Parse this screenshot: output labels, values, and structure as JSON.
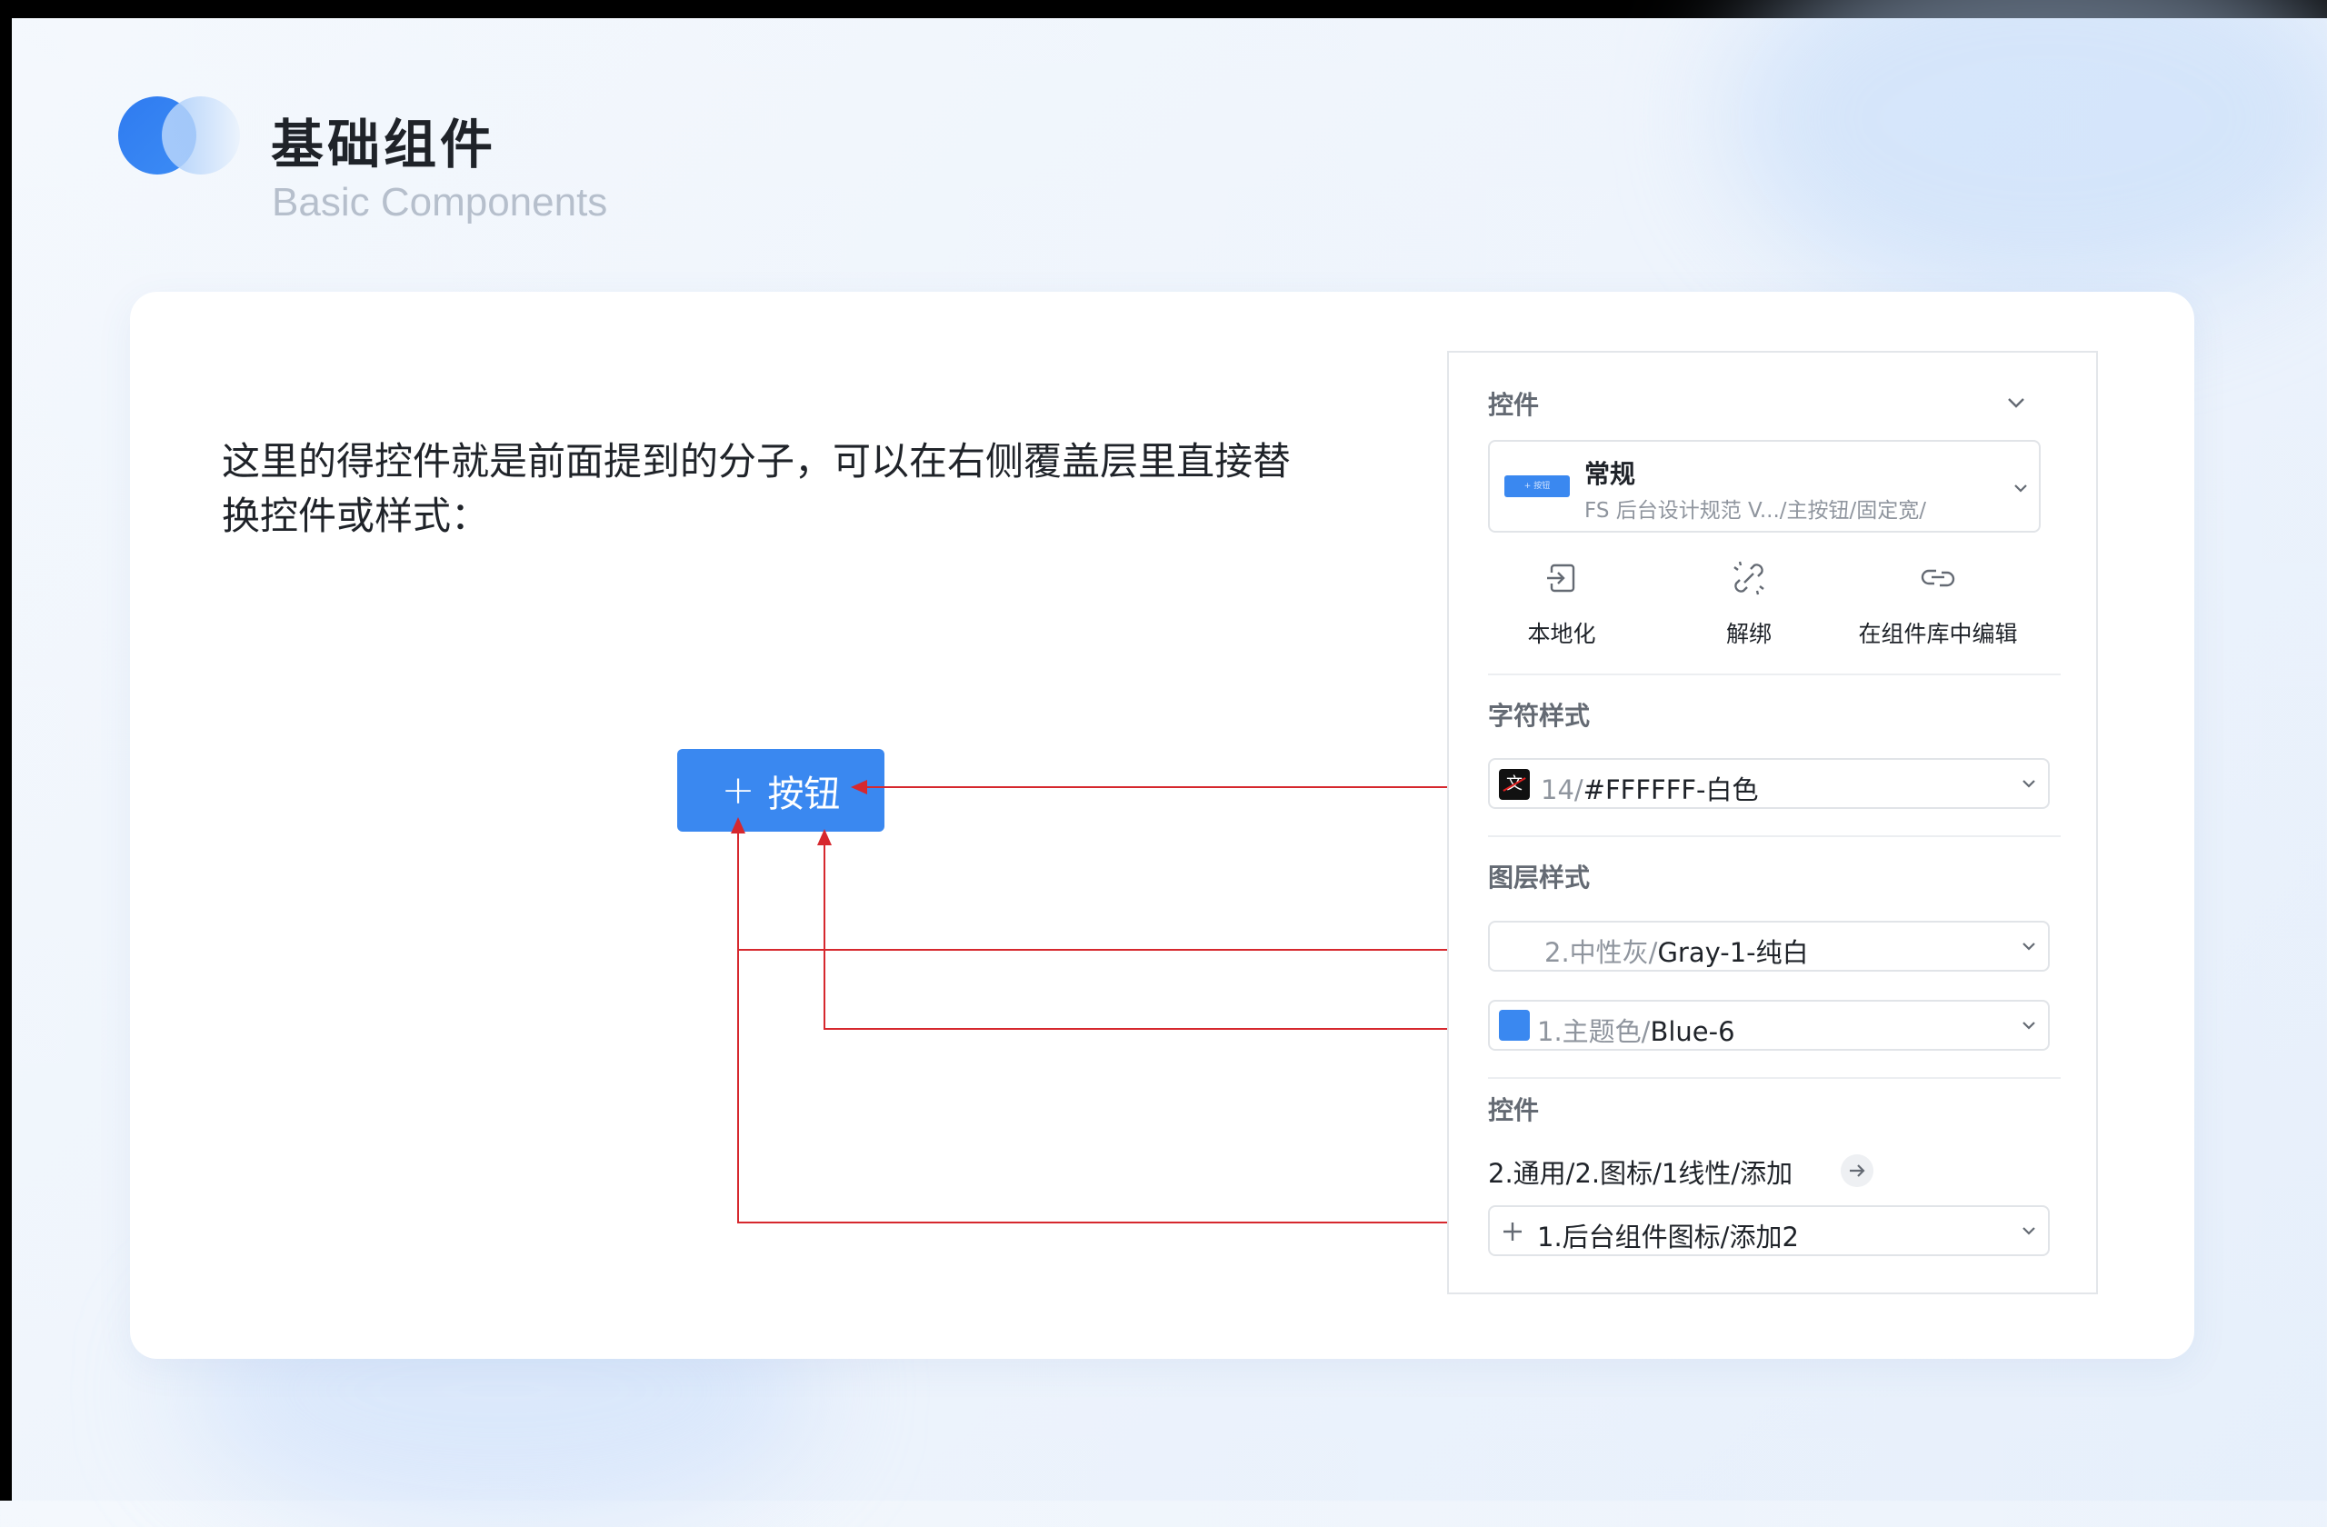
{
  "header": {
    "title_cn": "基础组件",
    "title_en": "Basic Components"
  },
  "description": "这里的得控件就是前面提到的分子，可以在右侧覆盖层里直接替换控件或样式：",
  "demo_button": {
    "icon": "plus-icon",
    "label": "按钮",
    "color": "#3a88f0"
  },
  "connector_color": "#d6282e",
  "panel": {
    "component_section": {
      "label": "控件",
      "name": "常规",
      "path": "FS 后台设计规范 V.../主按钮/固定宽/",
      "thumbnail_text": "+ 按钮"
    },
    "actions": [
      {
        "icon": "detach-local-icon",
        "label": "本地化"
      },
      {
        "icon": "unlink-icon",
        "label": "解绑"
      },
      {
        "icon": "link-edit-icon",
        "label": "在组件库中编辑"
      }
    ],
    "text_style": {
      "label": "字符样式",
      "value_prefix": "14/",
      "value_main": "#FFFFFF-白色"
    },
    "layer_style": {
      "label": "图层样式",
      "items": [
        {
          "prefix": "2.中性灰/",
          "main": "Gray-1-纯白",
          "swatch": "#ffffff"
        },
        {
          "prefix": "1.主题色/",
          "main": "Blue-6",
          "swatch": "#3a88f0"
        }
      ]
    },
    "icon_section": {
      "label": "控件",
      "path": "2.通用/2.图标/1线性/添加",
      "value": "1.后台组件图标/添加2"
    }
  }
}
